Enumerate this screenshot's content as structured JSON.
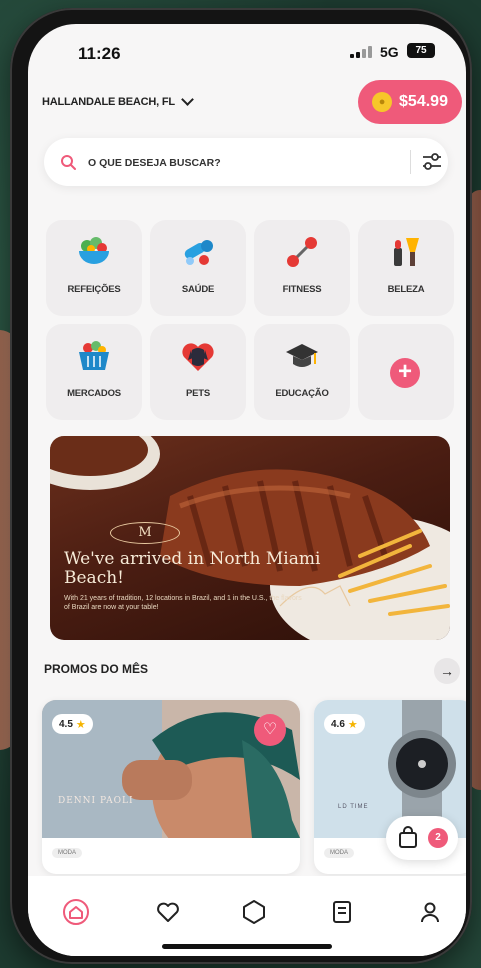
{
  "status_bar": {
    "time": "11:26",
    "network": "5G",
    "battery": "75"
  },
  "header": {
    "location": "HALLANDALE BEACH, FL",
    "balance": "$54.99"
  },
  "search": {
    "placeholder": "O QUE DESEJA BUSCAR?"
  },
  "categories": [
    {
      "label": "REFEIÇÕES",
      "icon": "salad-bowl-icon"
    },
    {
      "label": "SAÚDE",
      "icon": "pills-icon"
    },
    {
      "label": "FITNESS",
      "icon": "dumbbell-icon"
    },
    {
      "label": "BELEZA",
      "icon": "makeup-icon"
    },
    {
      "label": "MERCADOS",
      "icon": "basket-icon"
    },
    {
      "label": "PETS",
      "icon": "dog-heart-icon"
    },
    {
      "label": "EDUCAÇÃO",
      "icon": "graduation-cap-icon"
    },
    {
      "label": "",
      "icon": "plus-icon"
    }
  ],
  "banner": {
    "logo_letter": "M",
    "title": "We've arrived in North Miami Beach!",
    "subtitle": "With 21 years of tradition, 12 locations in Brazil, and 1 in the U.S., the flavors of Brazil are now at your table!"
  },
  "promos": {
    "title": "PROMOS DO MÊS",
    "cards": [
      {
        "rating": "4.5",
        "brand": "DENNI PAOLI",
        "tag": "MODA"
      },
      {
        "rating": "4.6",
        "brand": "LD TIME",
        "tag": "MODA"
      }
    ]
  },
  "cart": {
    "count": "2"
  },
  "nav": [
    "home-icon",
    "heart-icon",
    "hexagon-icon",
    "receipt-icon",
    "user-icon"
  ],
  "colors": {
    "accent": "#ef5a7a",
    "background": "#f7f6f6",
    "tile": "#efedee"
  }
}
